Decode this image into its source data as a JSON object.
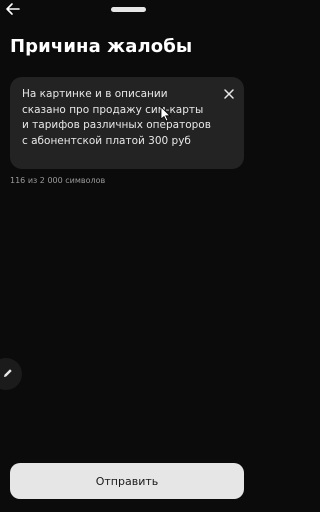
{
  "header": {
    "back_icon": "arrow-left-icon",
    "title": "Причина жалобы"
  },
  "complaint": {
    "text": "На картинке и в описании сказано про продажу сим-карты и тарифов различных операторов с абонентской платой 300 руб",
    "clear_icon": "close-icon"
  },
  "counter": "116 из 2 000 символов",
  "edit_icon": "pencil-icon",
  "submit_label": "Отправить",
  "colors": {
    "background": "#0b0b0b",
    "field": "#232323",
    "button": "#e6e6e6"
  }
}
